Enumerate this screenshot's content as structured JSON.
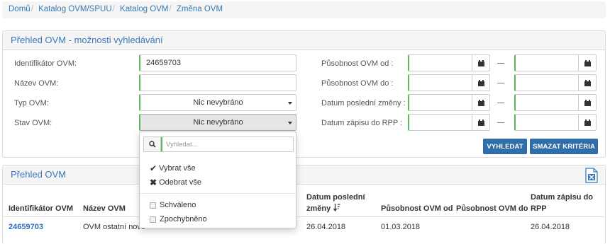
{
  "breadcrumb": {
    "items": [
      "Domů",
      "Katalog OVM/SPUU",
      "Katalog OVM"
    ],
    "current": "Změna OVM",
    "separator": "/"
  },
  "search_panel": {
    "title": "Přehled OVM - možnosti vyhledávání",
    "fields": {
      "identifikator": {
        "label": "Identifikátor OVM:",
        "value": "24659703"
      },
      "nazev": {
        "label": "Název OVM:",
        "value": ""
      },
      "typ": {
        "label": "Typ OVM:",
        "value": "Nic nevybráno"
      },
      "stav": {
        "label": "Stav OVM:",
        "value": "Nic nevybráno"
      },
      "pusobnost_od": {
        "label": "Působnost OVM od :"
      },
      "pusobnost_do": {
        "label": "Působnost OVM do :"
      },
      "datum_zmeny": {
        "label": "Datum poslední změny :"
      },
      "datum_zapisu": {
        "label": "Datum zápisu do RPP :"
      }
    },
    "range_separator": "—",
    "search_button": "VYHLEDAT",
    "clear_button": "SMAZAT KRITÉRIA"
  },
  "dropdown": {
    "search_placeholder": "Vyhledat...",
    "select_all": "Vybrat vše",
    "deselect_all": "Odebrat vše",
    "options": [
      {
        "label": "Schváleno",
        "checked": false
      },
      {
        "label": "Zpochybněno",
        "checked": false
      }
    ]
  },
  "list_panel": {
    "title": "Přehled OVM",
    "export_icon": "excel-export-icon",
    "columns": {
      "identifikator": "Identifikátor OVM",
      "nazev": "Název OVM",
      "datum_zmeny_line1": "Datum poslední",
      "datum_zmeny_line2": "změny",
      "pusobnost_od": "Působnost OVM od",
      "pusobnost_do": "Působnost OVM do",
      "datum_zapisu_line1": "Datum zápisu do",
      "datum_zapisu_line2": "RPP"
    },
    "rows": [
      {
        "identifikator": "24659703",
        "nazev": "OVM ostatní nove",
        "datum_zmeny": "26.04.2018",
        "pusobnost_od": "01.03.2018",
        "pusobnost_do": "",
        "datum_zapisu": "26.04.2018"
      }
    ]
  },
  "colors": {
    "link": "#337ab7",
    "primary_button": "#2f6ea8",
    "required_border": "#5cb85c",
    "panel_heading_bg": "#f5f5f5"
  }
}
